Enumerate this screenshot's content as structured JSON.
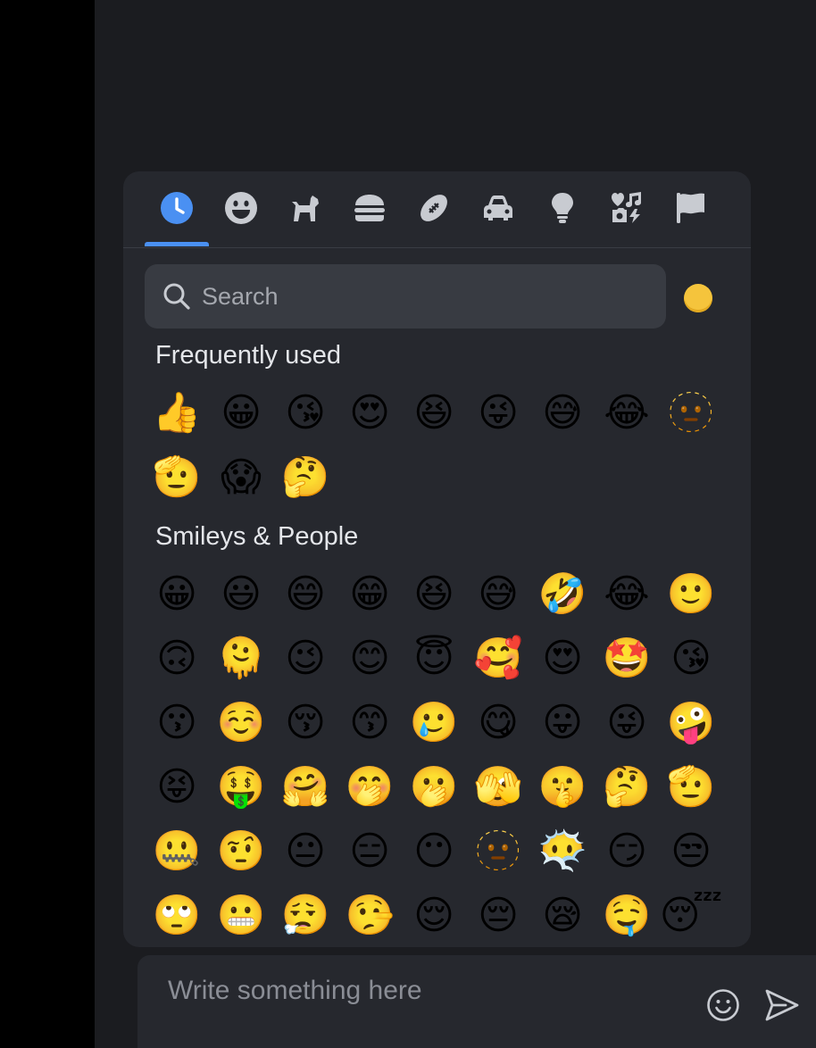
{
  "picker": {
    "categories": [
      {
        "name": "recent",
        "icon": "clock-icon",
        "active": true
      },
      {
        "name": "smileys",
        "icon": "smiley-icon",
        "active": false
      },
      {
        "name": "animals",
        "icon": "dog-icon",
        "active": false
      },
      {
        "name": "food",
        "icon": "burger-icon",
        "active": false
      },
      {
        "name": "activities",
        "icon": "football-icon",
        "active": false
      },
      {
        "name": "travel",
        "icon": "car-icon",
        "active": false
      },
      {
        "name": "objects",
        "icon": "lightbulb-icon",
        "active": false
      },
      {
        "name": "symbols",
        "icon": "symbols-icon",
        "active": false
      },
      {
        "name": "flags",
        "icon": "flag-icon",
        "active": false
      }
    ],
    "accent": "#4a90f2",
    "search": {
      "placeholder": "Search",
      "value": ""
    },
    "skin_tone": {
      "color": "#f5c43c"
    },
    "sections": [
      {
        "title": "Frequently used",
        "emojis": [
          "👍",
          "😀",
          "😘",
          "😍",
          "😆",
          "😜",
          "😅",
          "😂",
          "🫥",
          "🫡",
          "😱",
          "🤔"
        ]
      },
      {
        "title": "Smileys & People",
        "emojis": [
          "😀",
          "😃",
          "😄",
          "😁",
          "😆",
          "😅",
          "🤣",
          "😂",
          "🙂",
          "🙃",
          "🫠",
          "😉",
          "😊",
          "😇",
          "🥰",
          "😍",
          "🤩",
          "😘",
          "😗",
          "☺️",
          "😚",
          "😙",
          "🥲",
          "😋",
          "😛",
          "😜",
          "🤪",
          "😝",
          "🤑",
          "🤗",
          "🤭",
          "🫢",
          "🫣",
          "🤫",
          "🤔",
          "🫡",
          "🤐",
          "🤨",
          "😐",
          "😑",
          "😶",
          "🫥",
          "😶‍🌫️",
          "😏",
          "😒",
          "🙄",
          "😬",
          "😮‍💨",
          "🤥",
          "😌",
          "😔",
          "😪",
          "🤤",
          "😴"
        ]
      }
    ]
  },
  "composer": {
    "placeholder": "Write something here",
    "value": ""
  }
}
